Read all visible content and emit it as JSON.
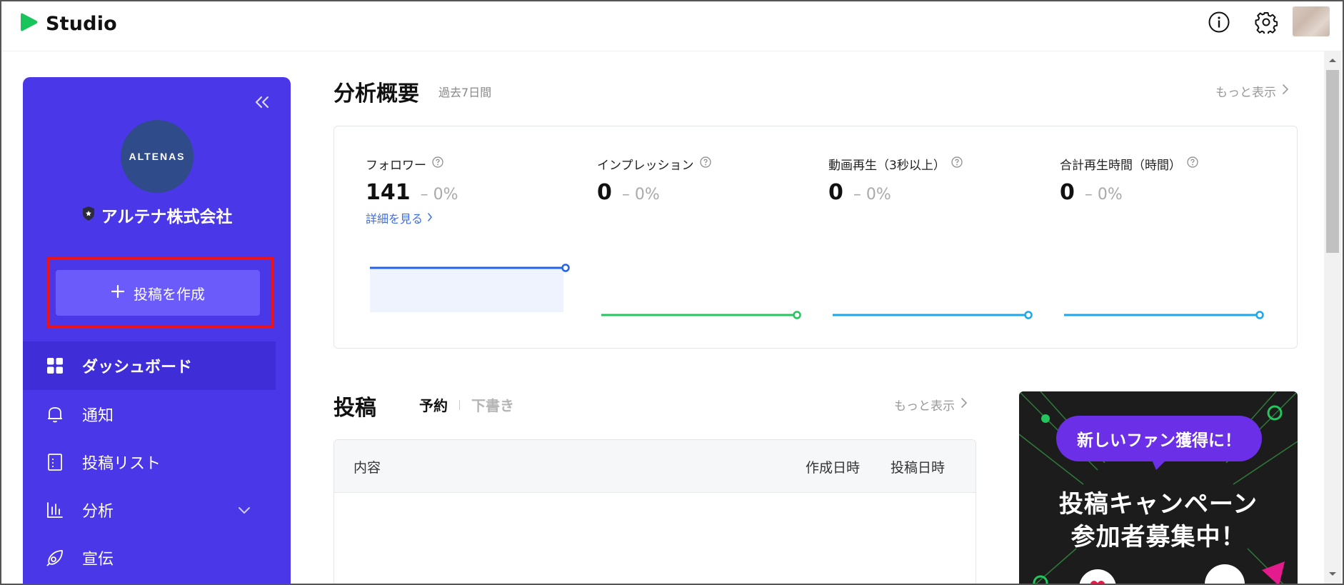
{
  "app": {
    "title": "Studio"
  },
  "header": {
    "icons": [
      "info-icon",
      "gear-icon"
    ],
    "avatar_color": "#d3c3b8"
  },
  "sidebar": {
    "org_logo_text": "ALTENAS",
    "org_name": "アルテナ株式会社",
    "create_button": "投稿を作成",
    "items": [
      {
        "label": "ダッシュボード",
        "icon": "dashboard-grid-icon",
        "active": true
      },
      {
        "label": "通知",
        "icon": "bell-icon"
      },
      {
        "label": "投稿リスト",
        "icon": "document-icon"
      },
      {
        "label": "分析",
        "icon": "bar-chart-icon",
        "expandable": true
      },
      {
        "label": "宣伝",
        "icon": "rocket-icon"
      }
    ],
    "bg_color": "#4a38e8",
    "highlight_color": "#e8131b"
  },
  "analytics": {
    "title": "分析概要",
    "period": "過去7日間",
    "more": "もっと表示",
    "metrics": [
      {
        "label": "フォロワー",
        "value": "141",
        "delta": "0%",
        "link": "詳細を見る",
        "line_color": "#2563eb"
      },
      {
        "label": "インプレッション",
        "value": "0",
        "delta": "0%",
        "line_color": "#22c55e"
      },
      {
        "label": "動画再生（3秒以上）",
        "value": "0",
        "delta": "0%",
        "line_color": "#1aa7ec"
      },
      {
        "label": "合計再生時間（時間）",
        "value": "0",
        "delta": "0%",
        "line_color": "#1aa7ec"
      }
    ]
  },
  "posts": {
    "title": "投稿",
    "tabs": [
      {
        "label": "予約",
        "active": true
      },
      {
        "label": "下書き",
        "active": false
      }
    ],
    "more": "もっと表示",
    "columns": [
      "内容",
      "作成日時",
      "投稿日時"
    ]
  },
  "banner": {
    "bubble": "新しいファン獲得に！",
    "line1": "投稿キャンペーン",
    "line2": "参加者募集中！"
  }
}
